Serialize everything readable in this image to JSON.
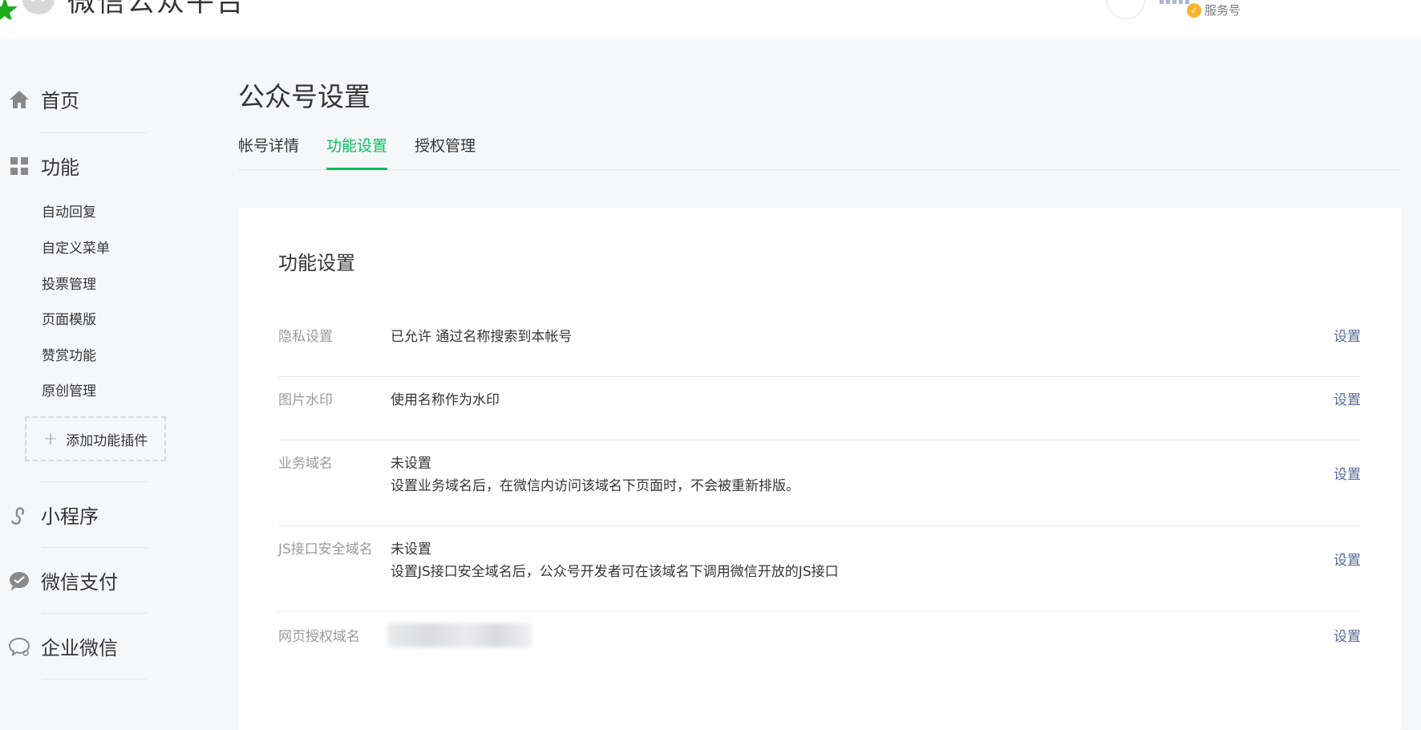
{
  "header": {
    "brand_title": "微信公众平台",
    "account_type": "服务号"
  },
  "sidebar": {
    "home": "首页",
    "features": "功能",
    "feature_items": [
      "自动回复",
      "自定义菜单",
      "投票管理",
      "页面模版",
      "赞赏功能",
      "原创管理"
    ],
    "add_plugin": "添加功能插件",
    "mini_program": "小程序",
    "wechat_pay": "微信支付",
    "work_wechat": "企业微信"
  },
  "main": {
    "page_title": "公众号设置",
    "tabs": [
      {
        "label": "帐号详情",
        "active": false
      },
      {
        "label": "功能设置",
        "active": true
      },
      {
        "label": "授权管理",
        "active": false
      }
    ],
    "card": {
      "title": "功能设置",
      "rows": [
        {
          "label": "隐私设置",
          "value": "已允许 通过名称搜索到本帐号",
          "desc": "",
          "action": "设置"
        },
        {
          "label": "图片水印",
          "value": "使用名称作为水印",
          "desc": "",
          "action": "设置"
        },
        {
          "label": "业务域名",
          "value": "未设置",
          "desc": "设置业务域名后，在微信内访问该域名下页面时，不会被重新排版。",
          "action": "设置"
        },
        {
          "label": "JS接口安全域名",
          "value": "未设置",
          "desc": "设置JS接口安全域名后，公众号开发者可在该域名下调用微信开放的JS接口",
          "action": "设置"
        },
        {
          "label": "网页授权域名",
          "value": "",
          "desc": "",
          "action": "设置"
        }
      ]
    }
  },
  "colors": {
    "accent": "#07c160",
    "link": "#576b95",
    "label_gray": "#9a9a9a",
    "text": "#353535",
    "background": "#f6f7f9"
  },
  "icons": {
    "home": "home-icon",
    "features": "grid-icon",
    "mini_program": "mini-program-icon",
    "wechat_pay": "wechat-pay-icon",
    "work_wechat": "work-wechat-icon",
    "add": "plus-icon",
    "verified": "verified-check-icon"
  }
}
